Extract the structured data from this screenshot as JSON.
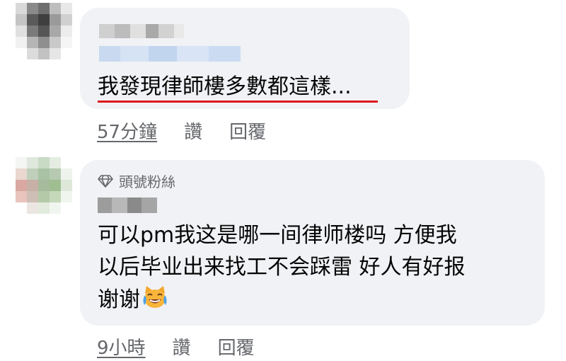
{
  "comments": [
    {
      "text_lines": [
        "我發現律師樓多數都這樣..."
      ],
      "time": "57分鐘",
      "like_label": "讚",
      "reply_label": "回覆"
    },
    {
      "badge_label": "頭號粉絲",
      "badge_icon": "diamond-icon",
      "text_lines": [
        "可以pm我这是哪一间律师楼吗 方便我",
        "以后毕业出来找工不会踩雷 好人有好报",
        "谢谢"
      ],
      "emoji": "laughing-cat-with-tears",
      "time": "9小時",
      "like_label": "讚",
      "reply_label": "回覆"
    }
  ],
  "colors": {
    "bubble": "#f0f2f5",
    "meta_text": "#65676b",
    "highlight_underline": "#e0161c"
  }
}
